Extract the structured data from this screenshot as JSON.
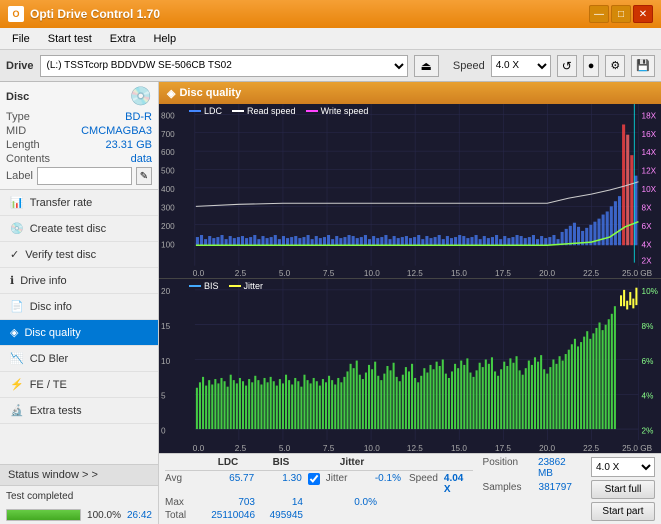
{
  "titlebar": {
    "title": "Opti Drive Control 1.70",
    "icon": "O",
    "btn_minimize": "—",
    "btn_maximize": "□",
    "btn_close": "✕"
  },
  "menubar": {
    "items": [
      "File",
      "Start test",
      "Extra",
      "Help"
    ]
  },
  "toolbar": {
    "drive_label": "Drive",
    "drive_value": "(L:) TSSTcorp BDDVDW SE-506CB TS02",
    "speed_label": "Speed",
    "speed_value": "4.0 X"
  },
  "disc": {
    "section_label": "Disc",
    "fields": [
      {
        "key": "Type",
        "value": "BD-R"
      },
      {
        "key": "MID",
        "value": "CMCMAGBA3"
      },
      {
        "key": "Length",
        "value": "23.31 GB"
      },
      {
        "key": "Contents",
        "value": "data"
      },
      {
        "key": "Label",
        "value": ""
      }
    ]
  },
  "nav": {
    "items": [
      {
        "label": "Transfer rate",
        "id": "transfer-rate",
        "active": false
      },
      {
        "label": "Create test disc",
        "id": "create-test-disc",
        "active": false
      },
      {
        "label": "Verify test disc",
        "id": "verify-test-disc",
        "active": false
      },
      {
        "label": "Drive info",
        "id": "drive-info",
        "active": false
      },
      {
        "label": "Disc info",
        "id": "disc-info",
        "active": false
      },
      {
        "label": "Disc quality",
        "id": "disc-quality",
        "active": true
      },
      {
        "label": "CD Bler",
        "id": "cd-bler",
        "active": false
      },
      {
        "label": "FE / TE",
        "id": "fe-te",
        "active": false
      },
      {
        "label": "Extra tests",
        "id": "extra-tests",
        "active": false
      }
    ]
  },
  "panel": {
    "title": "Disc quality",
    "icon": "◈"
  },
  "chart_top": {
    "legend": [
      {
        "label": "LDC",
        "color": "#4488ff"
      },
      {
        "label": "Read speed",
        "color": "#ffffff"
      },
      {
        "label": "Write speed",
        "color": "#ff44ff"
      }
    ],
    "y_axis_left": [
      "800",
      "700",
      "600",
      "500",
      "400",
      "300",
      "200",
      "100",
      "0"
    ],
    "y_axis_right": [
      "18X",
      "16X",
      "14X",
      "12X",
      "10X",
      "8X",
      "6X",
      "4X",
      "2X"
    ],
    "x_axis": [
      "0.0",
      "2.5",
      "5.0",
      "7.5",
      "10.0",
      "12.5",
      "15.0",
      "17.5",
      "20.0",
      "22.5",
      "25.0 GB"
    ]
  },
  "chart_bottom": {
    "legend": [
      {
        "label": "BIS",
        "color": "#44aaff"
      },
      {
        "label": "Jitter",
        "color": "#ffff44"
      }
    ],
    "y_axis_left": [
      "20",
      "15",
      "10",
      "5",
      "0"
    ],
    "y_axis_right": [
      "10%",
      "8%",
      "6%",
      "4%",
      "2%"
    ],
    "x_axis": [
      "0.0",
      "2.5",
      "5.0",
      "7.5",
      "10.0",
      "12.5",
      "15.0",
      "17.5",
      "20.0",
      "22.5",
      "25.0 GB"
    ]
  },
  "stats": {
    "headers": [
      "",
      "LDC",
      "BIS",
      "",
      "Jitter",
      "Speed",
      ""
    ],
    "rows": [
      {
        "label": "Avg",
        "ldc": "65.77",
        "bis": "1.30",
        "jitter": "-0.1%",
        "speed": "4.04 X"
      },
      {
        "label": "Max",
        "ldc": "703",
        "bis": "14",
        "jitter": "0.0%"
      },
      {
        "label": "Total",
        "ldc": "25110046",
        "bis": "495945",
        "jitter": ""
      }
    ],
    "position_label": "Position",
    "position_value": "23862 MB",
    "samples_label": "Samples",
    "samples_value": "381797",
    "speed_dropdown": "4.0 X",
    "jitter_checked": true,
    "jitter_label": "Jitter"
  },
  "buttons": {
    "start_full": "Start full",
    "start_part": "Start part"
  },
  "statusbar": {
    "status_window": "Status window > >",
    "status_text": "Test completed",
    "progress_pct": "100.0%",
    "time": "26:42",
    "progress_fill": 100
  }
}
